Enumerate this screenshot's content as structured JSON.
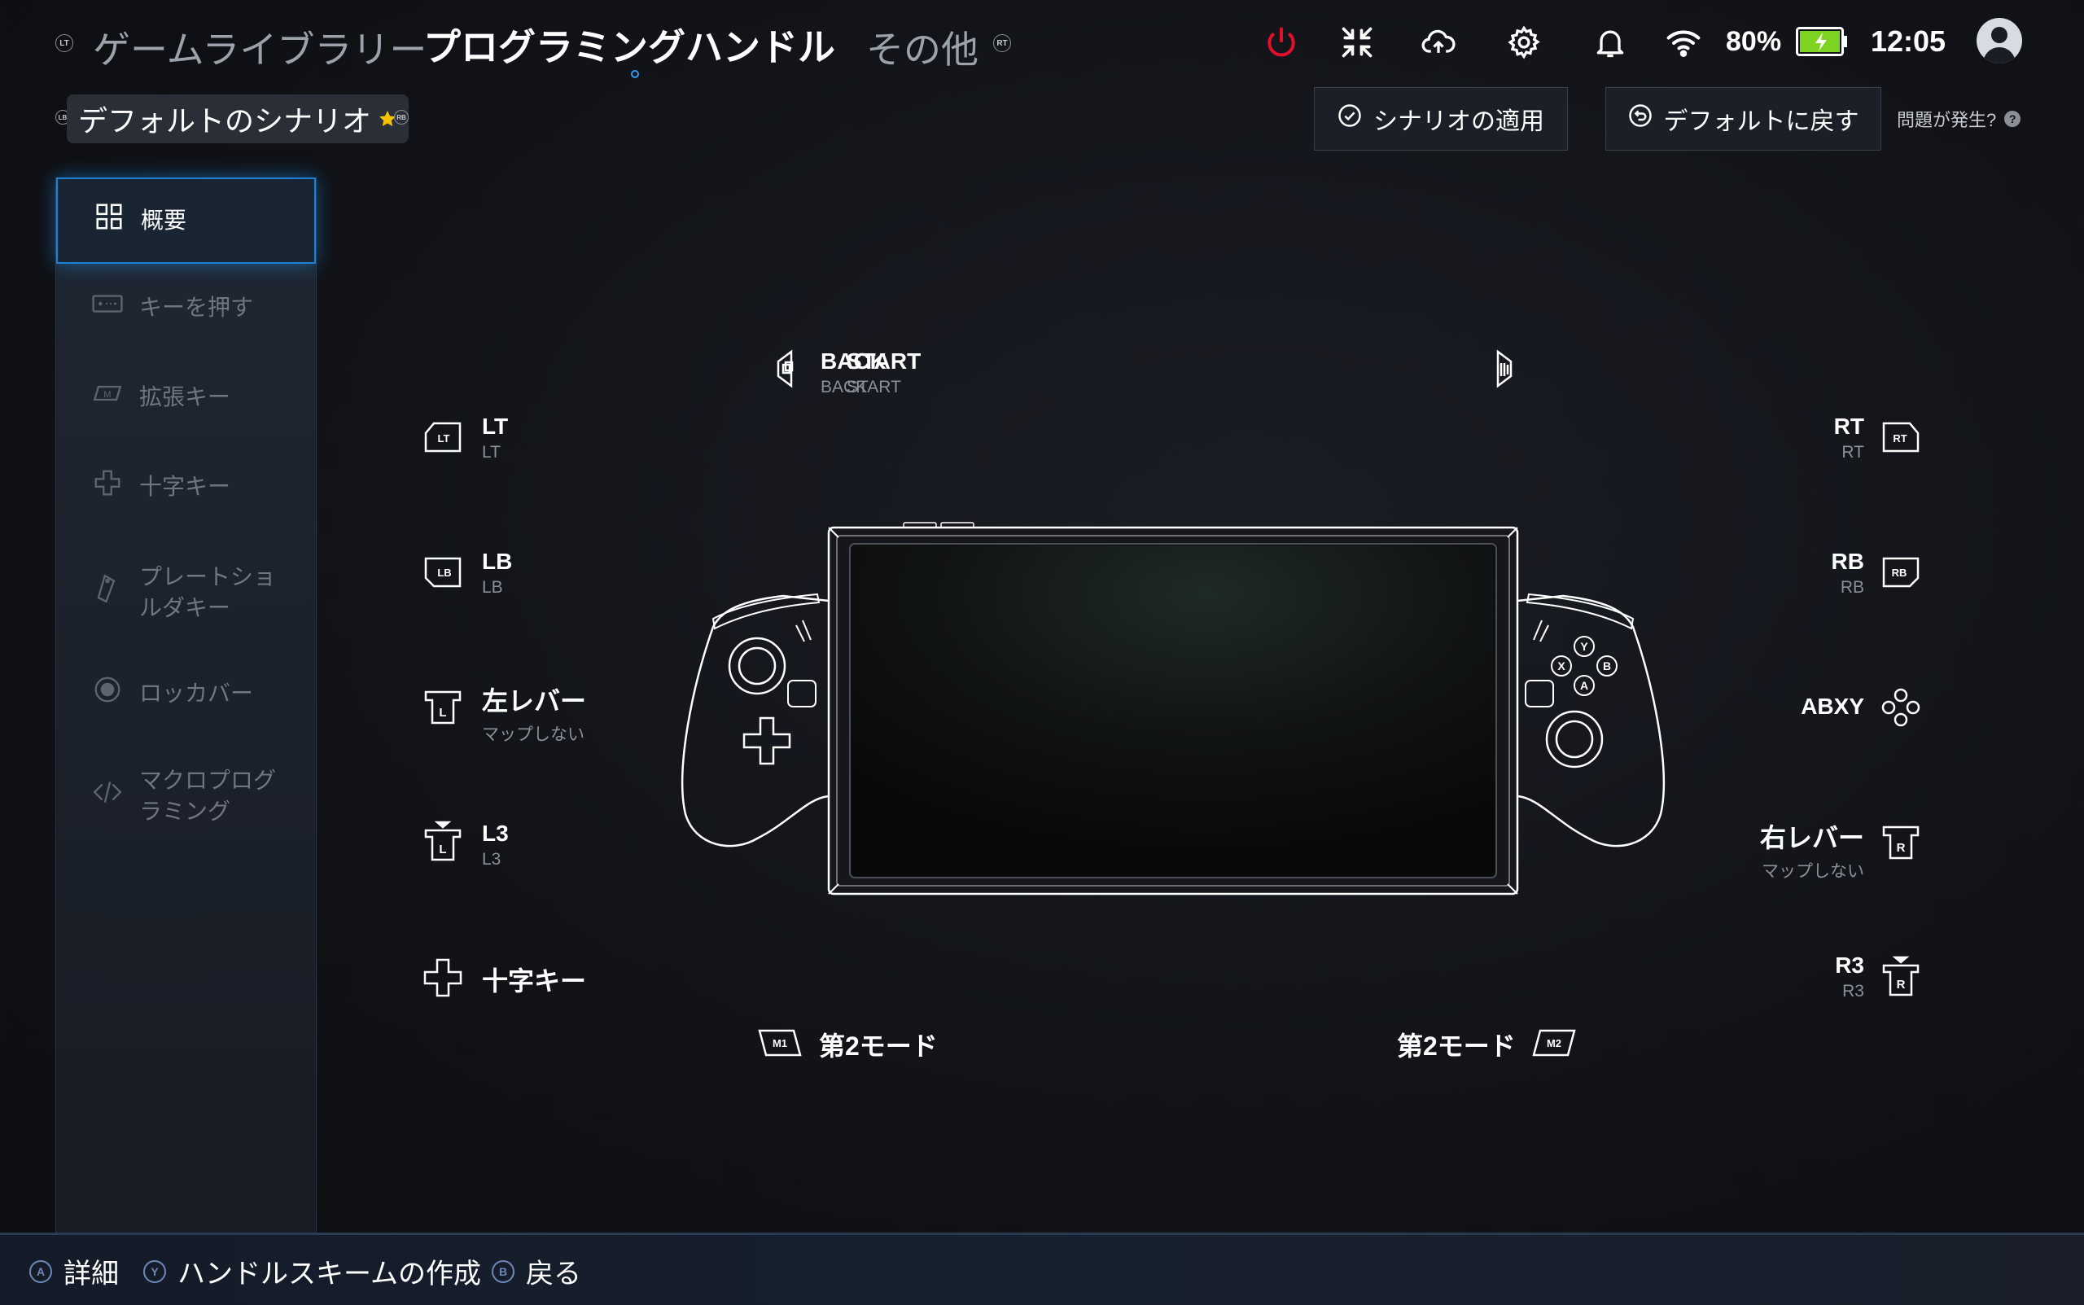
{
  "header": {
    "lt_hint": "LT",
    "rt_hint": "RT",
    "tabs": [
      "ゲームライブラリー",
      "プログラミングハンドル",
      "その他"
    ],
    "battery_percent": "80%",
    "time": "12:05"
  },
  "scenario": {
    "lb_hint": "LB",
    "rb_hint": "RB",
    "name": "デフォルトのシナリオ",
    "apply_label": "シナリオの適用",
    "reset_label": "デフォルトに戻す",
    "help_label": "問題が発生?",
    "help_mark": "?"
  },
  "sidebar": {
    "items": [
      {
        "label": "概要",
        "icon": "grid-icon"
      },
      {
        "label": "キーを押す",
        "icon": "keyboard-icon"
      },
      {
        "label": "拡張キー",
        "icon": "m-key-icon"
      },
      {
        "label": "十字キー",
        "icon": "dpad-icon"
      },
      {
        "label": "プレートショ\nルダキー",
        "icon": "plate-key-icon"
      },
      {
        "label": "ロッカバー",
        "icon": "joystick-icon"
      },
      {
        "label": "マクロプログ\nラミング",
        "icon": "code-icon"
      }
    ]
  },
  "mappings": {
    "back": {
      "title": "BACK",
      "sub": "BACK"
    },
    "start": {
      "title": "START",
      "sub": "START"
    },
    "lt": {
      "title": "LT",
      "sub": "LT"
    },
    "lb": {
      "title": "LB",
      "sub": "LB"
    },
    "left_stick": {
      "title": "左レバー",
      "sub": "マップしない"
    },
    "l3": {
      "title": "L3",
      "sub": "L3"
    },
    "dpad": {
      "title": "十字キー"
    },
    "m1": {
      "title": "第2モード"
    },
    "rt": {
      "title": "RT",
      "sub": "RT"
    },
    "rb": {
      "title": "RB",
      "sub": "RB"
    },
    "abxy": {
      "title": "ABXY"
    },
    "right_stick": {
      "title": "右レバー",
      "sub": "マップしない"
    },
    "r3": {
      "title": "R3",
      "sub": "R3"
    },
    "m2": {
      "title": "第2モード"
    }
  },
  "icon_text": {
    "lt": "LT",
    "lb": "LB",
    "l": "L",
    "rt": "RT",
    "rb": "RB",
    "r": "R",
    "m1": "M1",
    "m2": "M2",
    "m": "M",
    "x": "X",
    "y": "Y",
    "a": "A",
    "b": "B"
  },
  "footer": {
    "details": {
      "button": "A",
      "label": "詳細"
    },
    "create": {
      "button": "Y",
      "label": "ハンドルスキームの作成"
    },
    "back": {
      "button": "B",
      "label": "戻る"
    }
  },
  "colors": {
    "accent": "#1e7fd6",
    "power": "#e0102a",
    "battery": "#7ed321"
  }
}
